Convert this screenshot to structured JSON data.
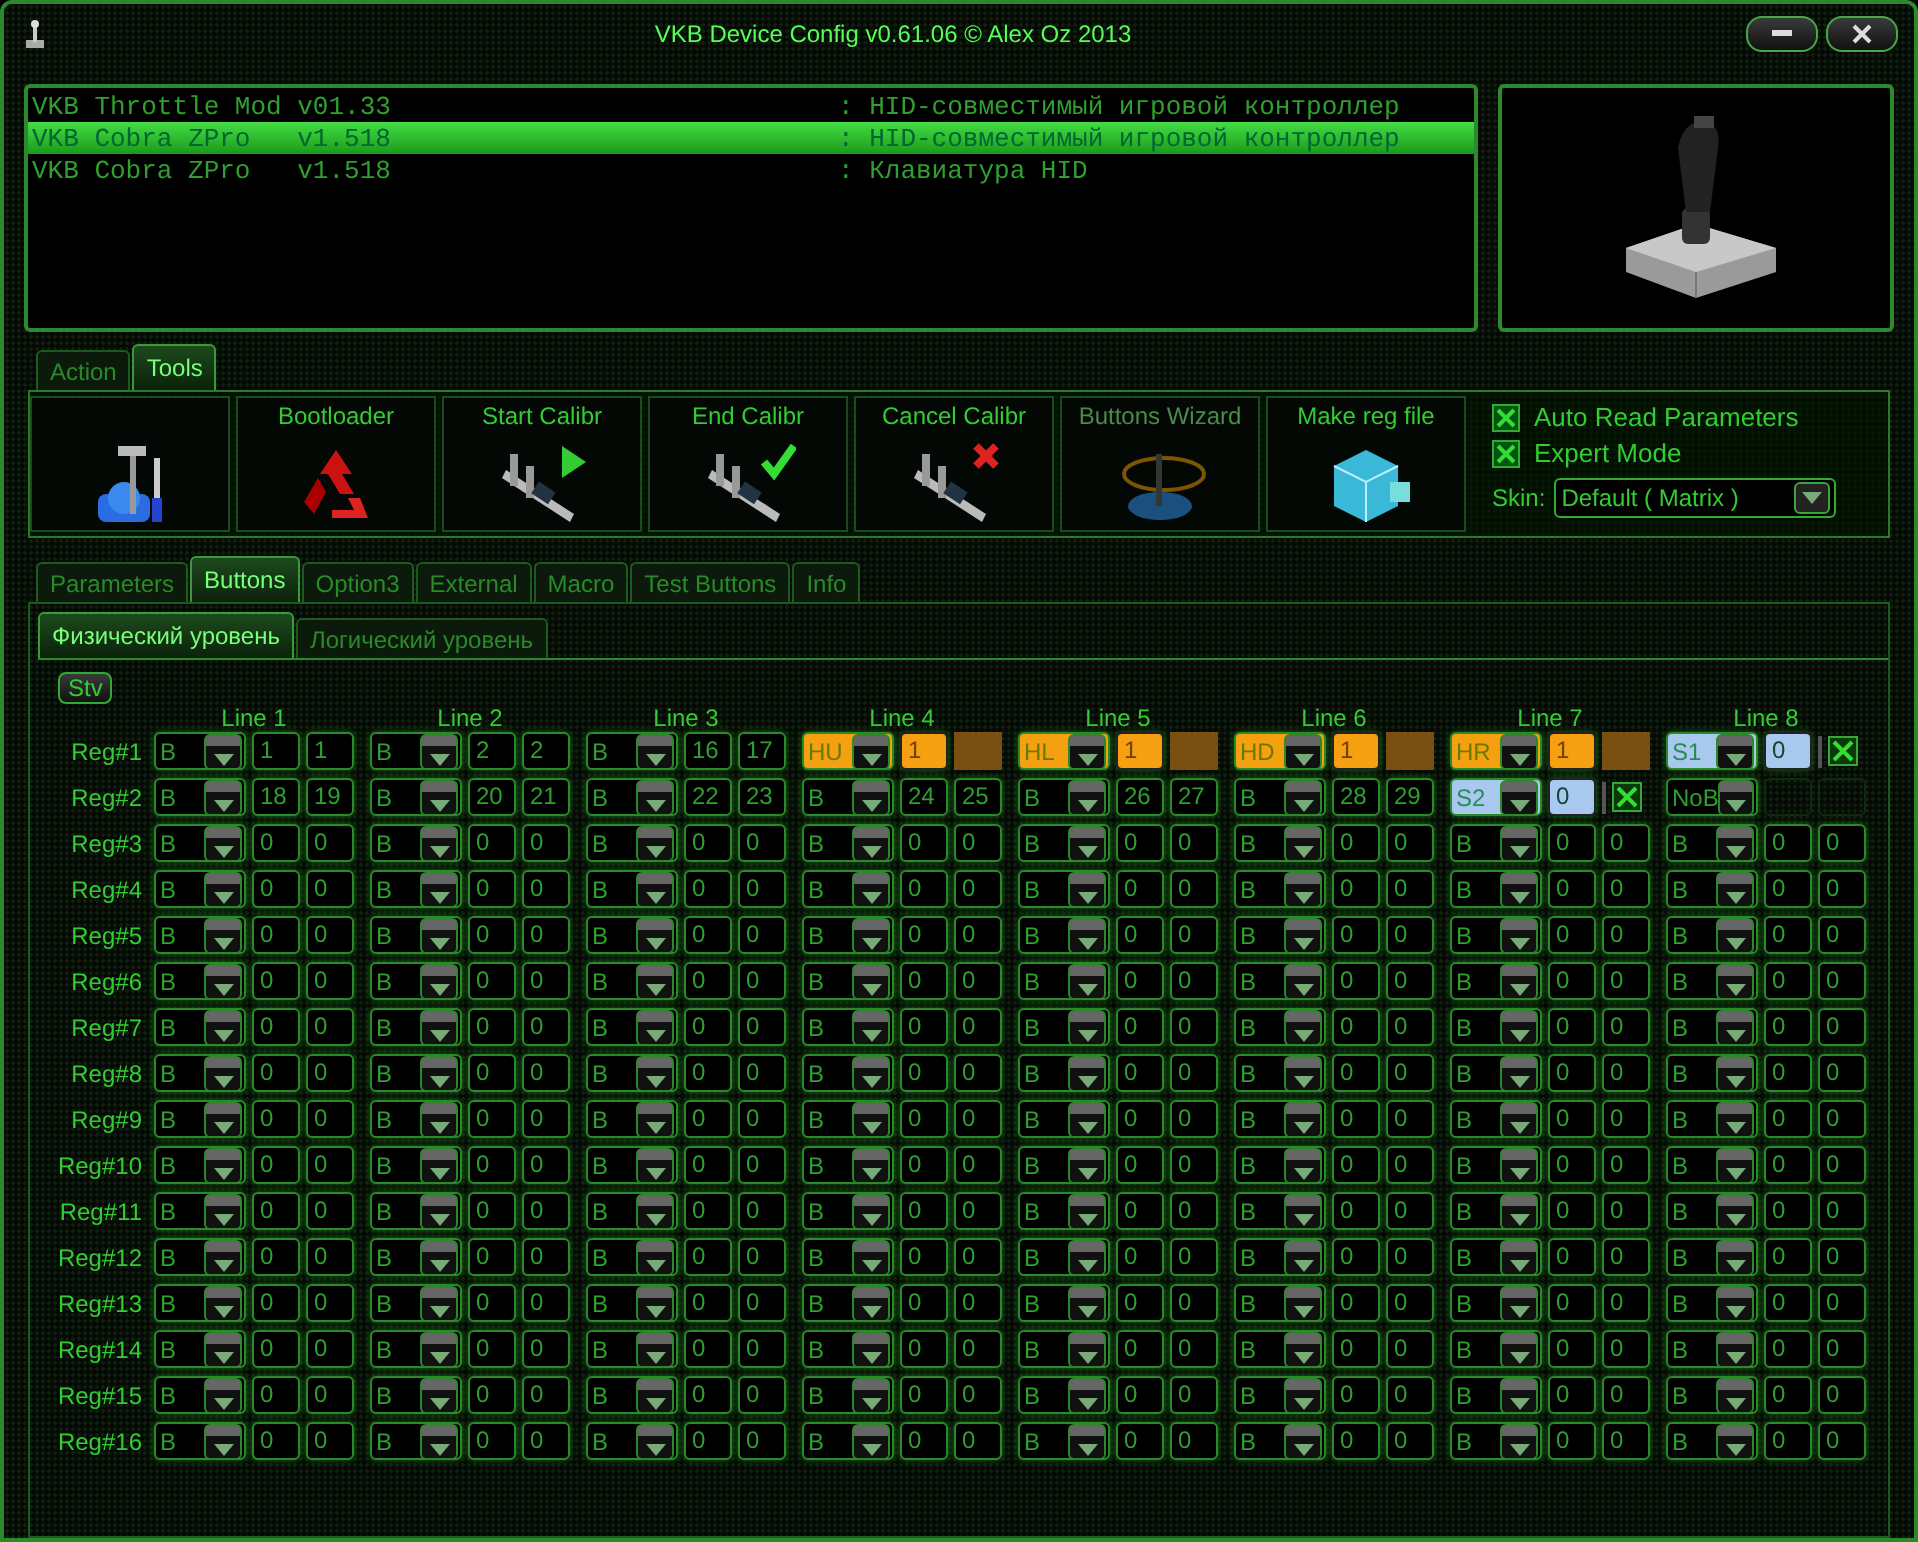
{
  "window": {
    "title": "VKB Device Config v0.61.06 © Alex Oz 2013"
  },
  "devices": [
    {
      "name": "VKB Throttle Mod v01.33",
      "description": ": HID-совместимый игровой контроллер",
      "selected": false
    },
    {
      "name": "VKB Cobra ZPro   v1.518",
      "description": ": HID-совместимый игровой контроллер",
      "selected": true
    },
    {
      "name": "VKB Cobra ZPro   v1.518",
      "description": ": Клавиатура HID",
      "selected": false
    }
  ],
  "top_tabs": [
    {
      "label": "Action",
      "selected": false
    },
    {
      "label": "Tools",
      "selected": true
    }
  ],
  "tools": [
    {
      "kind": "tools",
      "disabled": false
    },
    {
      "kind": "recycle",
      "label": "Bootloader",
      "disabled": false
    },
    {
      "kind": "caliper-play",
      "label": "Start Calibr",
      "disabled": false
    },
    {
      "kind": "caliper-check",
      "label": "End Calibr",
      "disabled": false
    },
    {
      "kind": "caliper-cross",
      "label": "Cancel Calibr",
      "disabled": false
    },
    {
      "kind": "wizard",
      "label": "Buttons Wizard",
      "disabled": true
    },
    {
      "kind": "cubes",
      "label": "Make reg file",
      "disabled": false
    }
  ],
  "options": [
    {
      "label": "Auto Read Parameters",
      "checked": true
    },
    {
      "label": "Expert Mode",
      "checked": true
    }
  ],
  "skin": {
    "label": "Skin:",
    "value": "Default ( Matrix )"
  },
  "main_tabs": [
    {
      "label": "Parameters",
      "selected": false
    },
    {
      "label": "Buttons",
      "selected": true
    },
    {
      "label": "Option3",
      "selected": false
    },
    {
      "label": "External",
      "selected": false
    },
    {
      "label": "Macro",
      "selected": false
    },
    {
      "label": "Test Buttons",
      "selected": false
    },
    {
      "label": "Info",
      "selected": false
    }
  ],
  "sub_tabs": [
    {
      "label": "Физический уровень",
      "selected": true
    },
    {
      "label": "Логический уровень",
      "selected": false
    }
  ],
  "grid": {
    "stv_button": "Stv",
    "line_headers": [
      "Line 1",
      "Line 2",
      "Line 3",
      "Line 4",
      "Line 5",
      "Line 6",
      "Line 7",
      "Line 8"
    ],
    "rows": [
      {
        "label": "Reg#1",
        "cells": [
          {
            "kind": "normal",
            "mode": "B",
            "values": [
              "1",
              "1"
            ]
          },
          {
            "kind": "normal",
            "mode": "B",
            "values": [
              "2",
              "2"
            ]
          },
          {
            "kind": "normal",
            "mode": "B",
            "values": [
              "16",
              "17"
            ]
          },
          {
            "kind": "hat",
            "mode": "HU",
            "values": [
              "1"
            ]
          },
          {
            "kind": "hat",
            "mode": "HL",
            "values": [
              "1"
            ]
          },
          {
            "kind": "hat",
            "mode": "HD",
            "values": [
              "1"
            ]
          },
          {
            "kind": "hat",
            "mode": "HR",
            "values": [
              "1"
            ]
          },
          {
            "kind": "shift",
            "mode": "S1",
            "values": [
              "0"
            ],
            "checked": true
          }
        ]
      },
      {
        "label": "Reg#2",
        "cells": [
          {
            "kind": "normal",
            "mode": "B",
            "values": [
              "18",
              "19"
            ]
          },
          {
            "kind": "normal",
            "mode": "B",
            "values": [
              "20",
              "21"
            ]
          },
          {
            "kind": "normal",
            "mode": "B",
            "values": [
              "22",
              "23"
            ]
          },
          {
            "kind": "normal",
            "mode": "B",
            "values": [
              "24",
              "25"
            ]
          },
          {
            "kind": "normal",
            "mode": "B",
            "values": [
              "26",
              "27"
            ]
          },
          {
            "kind": "normal",
            "mode": "B",
            "values": [
              "28",
              "29"
            ]
          },
          {
            "kind": "shift",
            "mode": "S2",
            "values": [
              "0"
            ],
            "checked": true
          },
          {
            "kind": "none",
            "mode": "NoB"
          }
        ]
      },
      {
        "label": "Reg#3",
        "cells": [
          {
            "kind": "normal",
            "mode": "B",
            "values": [
              "0",
              "0"
            ]
          },
          {
            "kind": "normal",
            "mode": "B",
            "values": [
              "0",
              "0"
            ]
          },
          {
            "kind": "normal",
            "mode": "B",
            "values": [
              "0",
              "0"
            ]
          },
          {
            "kind": "normal",
            "mode": "B",
            "values": [
              "0",
              "0"
            ]
          },
          {
            "kind": "normal",
            "mode": "B",
            "values": [
              "0",
              "0"
            ]
          },
          {
            "kind": "normal",
            "mode": "B",
            "values": [
              "0",
              "0"
            ]
          },
          {
            "kind": "normal",
            "mode": "B",
            "values": [
              "0",
              "0"
            ]
          },
          {
            "kind": "normal",
            "mode": "B",
            "values": [
              "0",
              "0"
            ]
          }
        ]
      },
      {
        "label": "Reg#4",
        "cells": [
          {
            "kind": "normal",
            "mode": "B",
            "values": [
              "0",
              "0"
            ]
          },
          {
            "kind": "normal",
            "mode": "B",
            "values": [
              "0",
              "0"
            ]
          },
          {
            "kind": "normal",
            "mode": "B",
            "values": [
              "0",
              "0"
            ]
          },
          {
            "kind": "normal",
            "mode": "B",
            "values": [
              "0",
              "0"
            ]
          },
          {
            "kind": "normal",
            "mode": "B",
            "values": [
              "0",
              "0"
            ]
          },
          {
            "kind": "normal",
            "mode": "B",
            "values": [
              "0",
              "0"
            ]
          },
          {
            "kind": "normal",
            "mode": "B",
            "values": [
              "0",
              "0"
            ]
          },
          {
            "kind": "normal",
            "mode": "B",
            "values": [
              "0",
              "0"
            ]
          }
        ]
      },
      {
        "label": "Reg#5",
        "cells": [
          {
            "kind": "normal",
            "mode": "B",
            "values": [
              "0",
              "0"
            ]
          },
          {
            "kind": "normal",
            "mode": "B",
            "values": [
              "0",
              "0"
            ]
          },
          {
            "kind": "normal",
            "mode": "B",
            "values": [
              "0",
              "0"
            ]
          },
          {
            "kind": "normal",
            "mode": "B",
            "values": [
              "0",
              "0"
            ]
          },
          {
            "kind": "normal",
            "mode": "B",
            "values": [
              "0",
              "0"
            ]
          },
          {
            "kind": "normal",
            "mode": "B",
            "values": [
              "0",
              "0"
            ]
          },
          {
            "kind": "normal",
            "mode": "B",
            "values": [
              "0",
              "0"
            ]
          },
          {
            "kind": "normal",
            "mode": "B",
            "values": [
              "0",
              "0"
            ]
          }
        ]
      },
      {
        "label": "Reg#6",
        "cells": [
          {
            "kind": "normal",
            "mode": "B",
            "values": [
              "0",
              "0"
            ]
          },
          {
            "kind": "normal",
            "mode": "B",
            "values": [
              "0",
              "0"
            ]
          },
          {
            "kind": "normal",
            "mode": "B",
            "values": [
              "0",
              "0"
            ]
          },
          {
            "kind": "normal",
            "mode": "B",
            "values": [
              "0",
              "0"
            ]
          },
          {
            "kind": "normal",
            "mode": "B",
            "values": [
              "0",
              "0"
            ]
          },
          {
            "kind": "normal",
            "mode": "B",
            "values": [
              "0",
              "0"
            ]
          },
          {
            "kind": "normal",
            "mode": "B",
            "values": [
              "0",
              "0"
            ]
          },
          {
            "kind": "normal",
            "mode": "B",
            "values": [
              "0",
              "0"
            ]
          }
        ]
      },
      {
        "label": "Reg#7",
        "cells": [
          {
            "kind": "normal",
            "mode": "B",
            "values": [
              "0",
              "0"
            ]
          },
          {
            "kind": "normal",
            "mode": "B",
            "values": [
              "0",
              "0"
            ]
          },
          {
            "kind": "normal",
            "mode": "B",
            "values": [
              "0",
              "0"
            ]
          },
          {
            "kind": "normal",
            "mode": "B",
            "values": [
              "0",
              "0"
            ]
          },
          {
            "kind": "normal",
            "mode": "B",
            "values": [
              "0",
              "0"
            ]
          },
          {
            "kind": "normal",
            "mode": "B",
            "values": [
              "0",
              "0"
            ]
          },
          {
            "kind": "normal",
            "mode": "B",
            "values": [
              "0",
              "0"
            ]
          },
          {
            "kind": "normal",
            "mode": "B",
            "values": [
              "0",
              "0"
            ]
          }
        ]
      },
      {
        "label": "Reg#8",
        "cells": [
          {
            "kind": "normal",
            "mode": "B",
            "values": [
              "0",
              "0"
            ]
          },
          {
            "kind": "normal",
            "mode": "B",
            "values": [
              "0",
              "0"
            ]
          },
          {
            "kind": "normal",
            "mode": "B",
            "values": [
              "0",
              "0"
            ]
          },
          {
            "kind": "normal",
            "mode": "B",
            "values": [
              "0",
              "0"
            ]
          },
          {
            "kind": "normal",
            "mode": "B",
            "values": [
              "0",
              "0"
            ]
          },
          {
            "kind": "normal",
            "mode": "B",
            "values": [
              "0",
              "0"
            ]
          },
          {
            "kind": "normal",
            "mode": "B",
            "values": [
              "0",
              "0"
            ]
          },
          {
            "kind": "normal",
            "mode": "B",
            "values": [
              "0",
              "0"
            ]
          }
        ]
      },
      {
        "label": "Reg#9",
        "cells": [
          {
            "kind": "normal",
            "mode": "B",
            "values": [
              "0",
              "0"
            ]
          },
          {
            "kind": "normal",
            "mode": "B",
            "values": [
              "0",
              "0"
            ]
          },
          {
            "kind": "normal",
            "mode": "B",
            "values": [
              "0",
              "0"
            ]
          },
          {
            "kind": "normal",
            "mode": "B",
            "values": [
              "0",
              "0"
            ]
          },
          {
            "kind": "normal",
            "mode": "B",
            "values": [
              "0",
              "0"
            ]
          },
          {
            "kind": "normal",
            "mode": "B",
            "values": [
              "0",
              "0"
            ]
          },
          {
            "kind": "normal",
            "mode": "B",
            "values": [
              "0",
              "0"
            ]
          },
          {
            "kind": "normal",
            "mode": "B",
            "values": [
              "0",
              "0"
            ]
          }
        ]
      },
      {
        "label": "Reg#10",
        "cells": [
          {
            "kind": "normal",
            "mode": "B",
            "values": [
              "0",
              "0"
            ]
          },
          {
            "kind": "normal",
            "mode": "B",
            "values": [
              "0",
              "0"
            ]
          },
          {
            "kind": "normal",
            "mode": "B",
            "values": [
              "0",
              "0"
            ]
          },
          {
            "kind": "normal",
            "mode": "B",
            "values": [
              "0",
              "0"
            ]
          },
          {
            "kind": "normal",
            "mode": "B",
            "values": [
              "0",
              "0"
            ]
          },
          {
            "kind": "normal",
            "mode": "B",
            "values": [
              "0",
              "0"
            ]
          },
          {
            "kind": "normal",
            "mode": "B",
            "values": [
              "0",
              "0"
            ]
          },
          {
            "kind": "normal",
            "mode": "B",
            "values": [
              "0",
              "0"
            ]
          }
        ]
      },
      {
        "label": "Reg#11",
        "cells": [
          {
            "kind": "normal",
            "mode": "B",
            "values": [
              "0",
              "0"
            ]
          },
          {
            "kind": "normal",
            "mode": "B",
            "values": [
              "0",
              "0"
            ]
          },
          {
            "kind": "normal",
            "mode": "B",
            "values": [
              "0",
              "0"
            ]
          },
          {
            "kind": "normal",
            "mode": "B",
            "values": [
              "0",
              "0"
            ]
          },
          {
            "kind": "normal",
            "mode": "B",
            "values": [
              "0",
              "0"
            ]
          },
          {
            "kind": "normal",
            "mode": "B",
            "values": [
              "0",
              "0"
            ]
          },
          {
            "kind": "normal",
            "mode": "B",
            "values": [
              "0",
              "0"
            ]
          },
          {
            "kind": "normal",
            "mode": "B",
            "values": [
              "0",
              "0"
            ]
          }
        ]
      },
      {
        "label": "Reg#12",
        "cells": [
          {
            "kind": "normal",
            "mode": "B",
            "values": [
              "0",
              "0"
            ]
          },
          {
            "kind": "normal",
            "mode": "B",
            "values": [
              "0",
              "0"
            ]
          },
          {
            "kind": "normal",
            "mode": "B",
            "values": [
              "0",
              "0"
            ]
          },
          {
            "kind": "normal",
            "mode": "B",
            "values": [
              "0",
              "0"
            ]
          },
          {
            "kind": "normal",
            "mode": "B",
            "values": [
              "0",
              "0"
            ]
          },
          {
            "kind": "normal",
            "mode": "B",
            "values": [
              "0",
              "0"
            ]
          },
          {
            "kind": "normal",
            "mode": "B",
            "values": [
              "0",
              "0"
            ]
          },
          {
            "kind": "normal",
            "mode": "B",
            "values": [
              "0",
              "0"
            ]
          }
        ]
      },
      {
        "label": "Reg#13",
        "cells": [
          {
            "kind": "normal",
            "mode": "B",
            "values": [
              "0",
              "0"
            ]
          },
          {
            "kind": "normal",
            "mode": "B",
            "values": [
              "0",
              "0"
            ]
          },
          {
            "kind": "normal",
            "mode": "B",
            "values": [
              "0",
              "0"
            ]
          },
          {
            "kind": "normal",
            "mode": "B",
            "values": [
              "0",
              "0"
            ]
          },
          {
            "kind": "normal",
            "mode": "B",
            "values": [
              "0",
              "0"
            ]
          },
          {
            "kind": "normal",
            "mode": "B",
            "values": [
              "0",
              "0"
            ]
          },
          {
            "kind": "normal",
            "mode": "B",
            "values": [
              "0",
              "0"
            ]
          },
          {
            "kind": "normal",
            "mode": "B",
            "values": [
              "0",
              "0"
            ]
          }
        ]
      },
      {
        "label": "Reg#14",
        "cells": [
          {
            "kind": "normal",
            "mode": "B",
            "values": [
              "0",
              "0"
            ]
          },
          {
            "kind": "normal",
            "mode": "B",
            "values": [
              "0",
              "0"
            ]
          },
          {
            "kind": "normal",
            "mode": "B",
            "values": [
              "0",
              "0"
            ]
          },
          {
            "kind": "normal",
            "mode": "B",
            "values": [
              "0",
              "0"
            ]
          },
          {
            "kind": "normal",
            "mode": "B",
            "values": [
              "0",
              "0"
            ]
          },
          {
            "kind": "normal",
            "mode": "B",
            "values": [
              "0",
              "0"
            ]
          },
          {
            "kind": "normal",
            "mode": "B",
            "values": [
              "0",
              "0"
            ]
          },
          {
            "kind": "normal",
            "mode": "B",
            "values": [
              "0",
              "0"
            ]
          }
        ]
      },
      {
        "label": "Reg#15",
        "cells": [
          {
            "kind": "normal",
            "mode": "B",
            "values": [
              "0",
              "0"
            ]
          },
          {
            "kind": "normal",
            "mode": "B",
            "values": [
              "0",
              "0"
            ]
          },
          {
            "kind": "normal",
            "mode": "B",
            "values": [
              "0",
              "0"
            ]
          },
          {
            "kind": "normal",
            "mode": "B",
            "values": [
              "0",
              "0"
            ]
          },
          {
            "kind": "normal",
            "mode": "B",
            "values": [
              "0",
              "0"
            ]
          },
          {
            "kind": "normal",
            "mode": "B",
            "values": [
              "0",
              "0"
            ]
          },
          {
            "kind": "normal",
            "mode": "B",
            "values": [
              "0",
              "0"
            ]
          },
          {
            "kind": "normal",
            "mode": "B",
            "values": [
              "0",
              "0"
            ]
          }
        ]
      },
      {
        "label": "Reg#16",
        "cells": [
          {
            "kind": "normal",
            "mode": "B",
            "values": [
              "0",
              "0"
            ]
          },
          {
            "kind": "normal",
            "mode": "B",
            "values": [
              "0",
              "0"
            ]
          },
          {
            "kind": "normal",
            "mode": "B",
            "values": [
              "0",
              "0"
            ]
          },
          {
            "kind": "normal",
            "mode": "B",
            "values": [
              "0",
              "0"
            ]
          },
          {
            "kind": "normal",
            "mode": "B",
            "values": [
              "0",
              "0"
            ]
          },
          {
            "kind": "normal",
            "mode": "B",
            "values": [
              "0",
              "0"
            ]
          },
          {
            "kind": "normal",
            "mode": "B",
            "values": [
              "0",
              "0"
            ]
          },
          {
            "kind": "normal",
            "mode": "B",
            "values": [
              "0",
              "0"
            ]
          }
        ]
      }
    ]
  }
}
